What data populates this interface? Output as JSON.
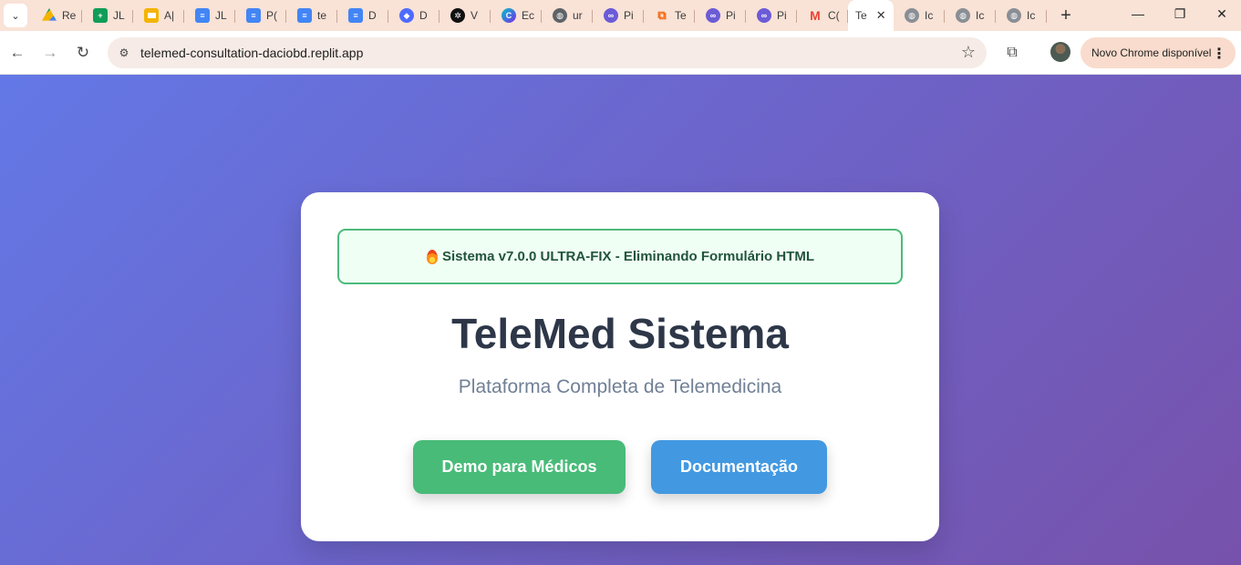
{
  "browser": {
    "tabs": [
      {
        "title": "Re",
        "icon": "google-drive-icon",
        "color": "#1fa463"
      },
      {
        "title": "JL",
        "icon": "google-sheets-icon",
        "color": "#0f9d58"
      },
      {
        "title": "A|",
        "icon": "google-slides-icon",
        "color": "#f4b400"
      },
      {
        "title": "JL",
        "icon": "google-docs-icon",
        "color": "#4285f4"
      },
      {
        "title": "P(",
        "icon": "google-docs-icon",
        "color": "#4285f4"
      },
      {
        "title": "te",
        "icon": "google-docs-icon",
        "color": "#4285f4"
      },
      {
        "title": "D",
        "icon": "google-docs-icon",
        "color": "#4285f4"
      },
      {
        "title": "D",
        "icon": "deepseek-icon",
        "color": "#4d6bfe"
      },
      {
        "title": "V",
        "icon": "openai-icon",
        "color": "#111111"
      },
      {
        "title": "Ec",
        "icon": "canva-icon",
        "color": "#00c4cc"
      },
      {
        "title": "ur",
        "icon": "globe-icon",
        "color": "#5f6368"
      },
      {
        "title": "Pi",
        "icon": "meta-icon",
        "color": "#6b5bd6"
      },
      {
        "title": "Te",
        "icon": "replit-icon",
        "color": "#f26207"
      },
      {
        "title": "Pi",
        "icon": "meta-icon",
        "color": "#6b5bd6"
      },
      {
        "title": "Pi",
        "icon": "meta-icon",
        "color": "#6b5bd6"
      },
      {
        "title": "C(",
        "icon": "gmail-icon",
        "color": "#ea4335"
      }
    ],
    "active_tab": {
      "title": "Te",
      "close": "✕"
    },
    "trailing_tabs": [
      {
        "title": "Ic",
        "icon": "globe-icon"
      },
      {
        "title": "Ic",
        "icon": "globe-icon"
      },
      {
        "title": "Ic",
        "icon": "globe-icon"
      }
    ],
    "url": "telemed-consultation-daciobd.replit.app",
    "update_label": "Novo Chrome disponível"
  },
  "page": {
    "banner_text": "Sistema v7.0.0 ULTRA-FIX - Eliminando Formulário HTML",
    "title": "TeleMed Sistema",
    "subtitle": "Plataforma Completa de Telemedicina",
    "buttons": {
      "demo_label": "Demo para Médicos",
      "docs_label": "Documentação"
    },
    "colors": {
      "gradient_start": "#6378e6",
      "gradient_end": "#7752ab",
      "demo_button": "#48bb78",
      "docs_button": "#4299e1",
      "banner_border": "#4cbb7b"
    }
  }
}
